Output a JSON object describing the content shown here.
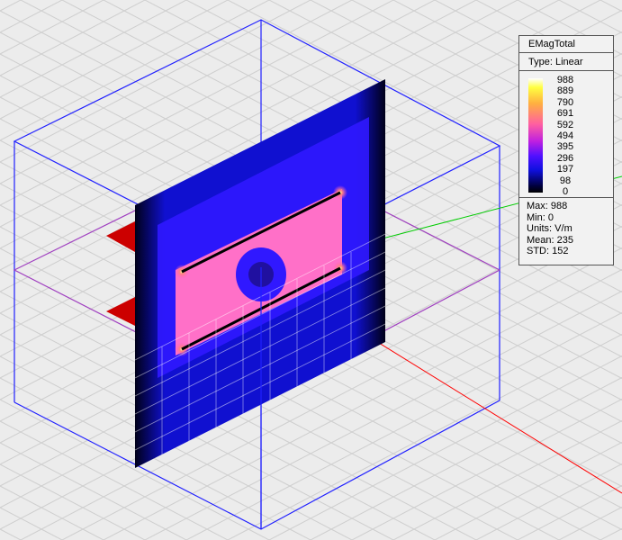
{
  "legend": {
    "title": "EMagTotal",
    "type": "Type: Linear",
    "ticks": [
      "988",
      "889",
      "790",
      "691",
      "592",
      "494",
      "395",
      "296",
      "197",
      "98",
      "0"
    ],
    "stats": [
      "Max: 988",
      "Min: 0",
      "Units: V/m",
      "Mean: 235",
      "STD: 152"
    ]
  },
  "colors": {
    "box": "#2020ff",
    "plane": "#a040c0",
    "x_axis": "#ff0000",
    "y_axis": "#00cc00",
    "port": "#cc0000"
  }
}
